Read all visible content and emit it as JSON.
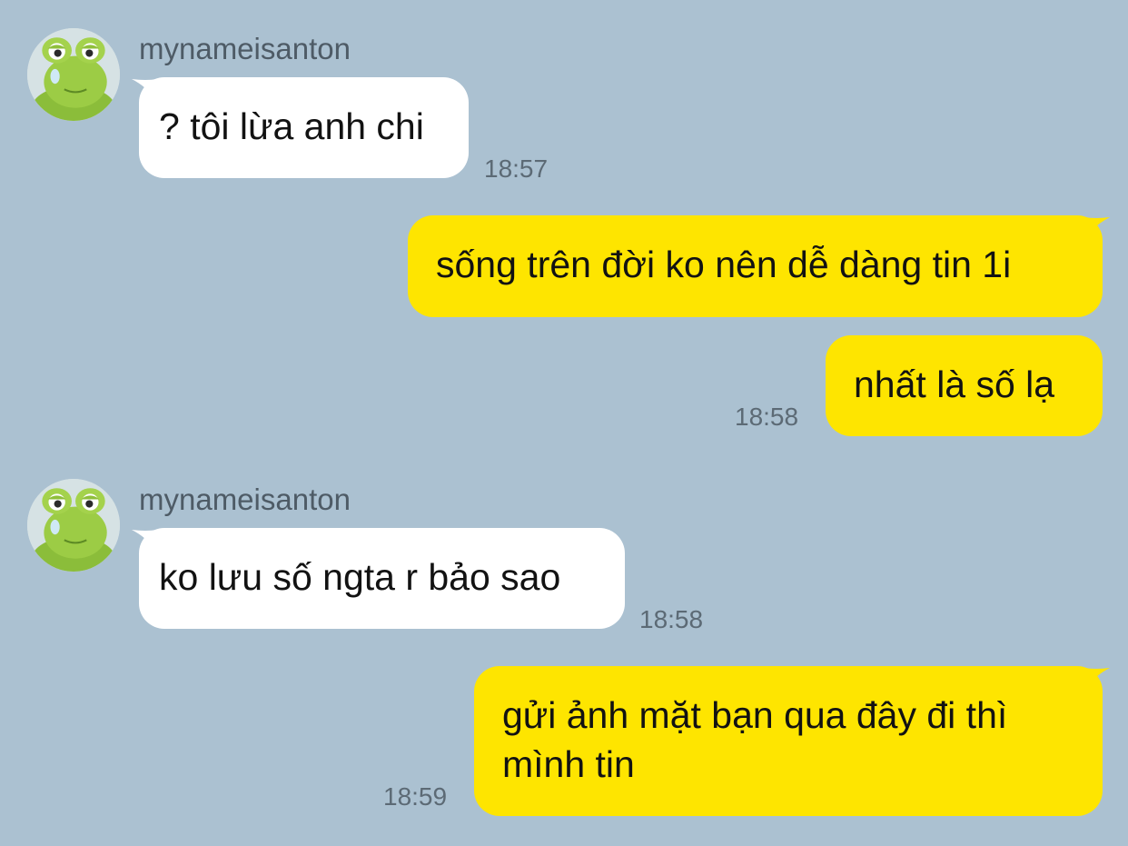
{
  "theme": {
    "background": "#abc1d1",
    "incoming_bubble": "#ffffff",
    "outgoing_bubble": "#fee500"
  },
  "messages": [
    {
      "direction": "incoming",
      "sender": "mynameisanton",
      "avatar_icon": "frog-avatar-icon",
      "text": "? tôi lừa anh chi",
      "time": "18:57"
    },
    {
      "direction": "outgoing",
      "text": "sống trên đời ko nên dễ dàng tin 1i",
      "time": ""
    },
    {
      "direction": "outgoing",
      "text": "nhất là số lạ",
      "time": "18:58"
    },
    {
      "direction": "incoming",
      "sender": "mynameisanton",
      "avatar_icon": "frog-avatar-icon",
      "text": "ko lưu số ngta r bảo sao",
      "time": "18:58"
    },
    {
      "direction": "outgoing",
      "text": "gửi ảnh mặt bạn qua đây đi thì mình tin",
      "time": "18:59"
    }
  ]
}
